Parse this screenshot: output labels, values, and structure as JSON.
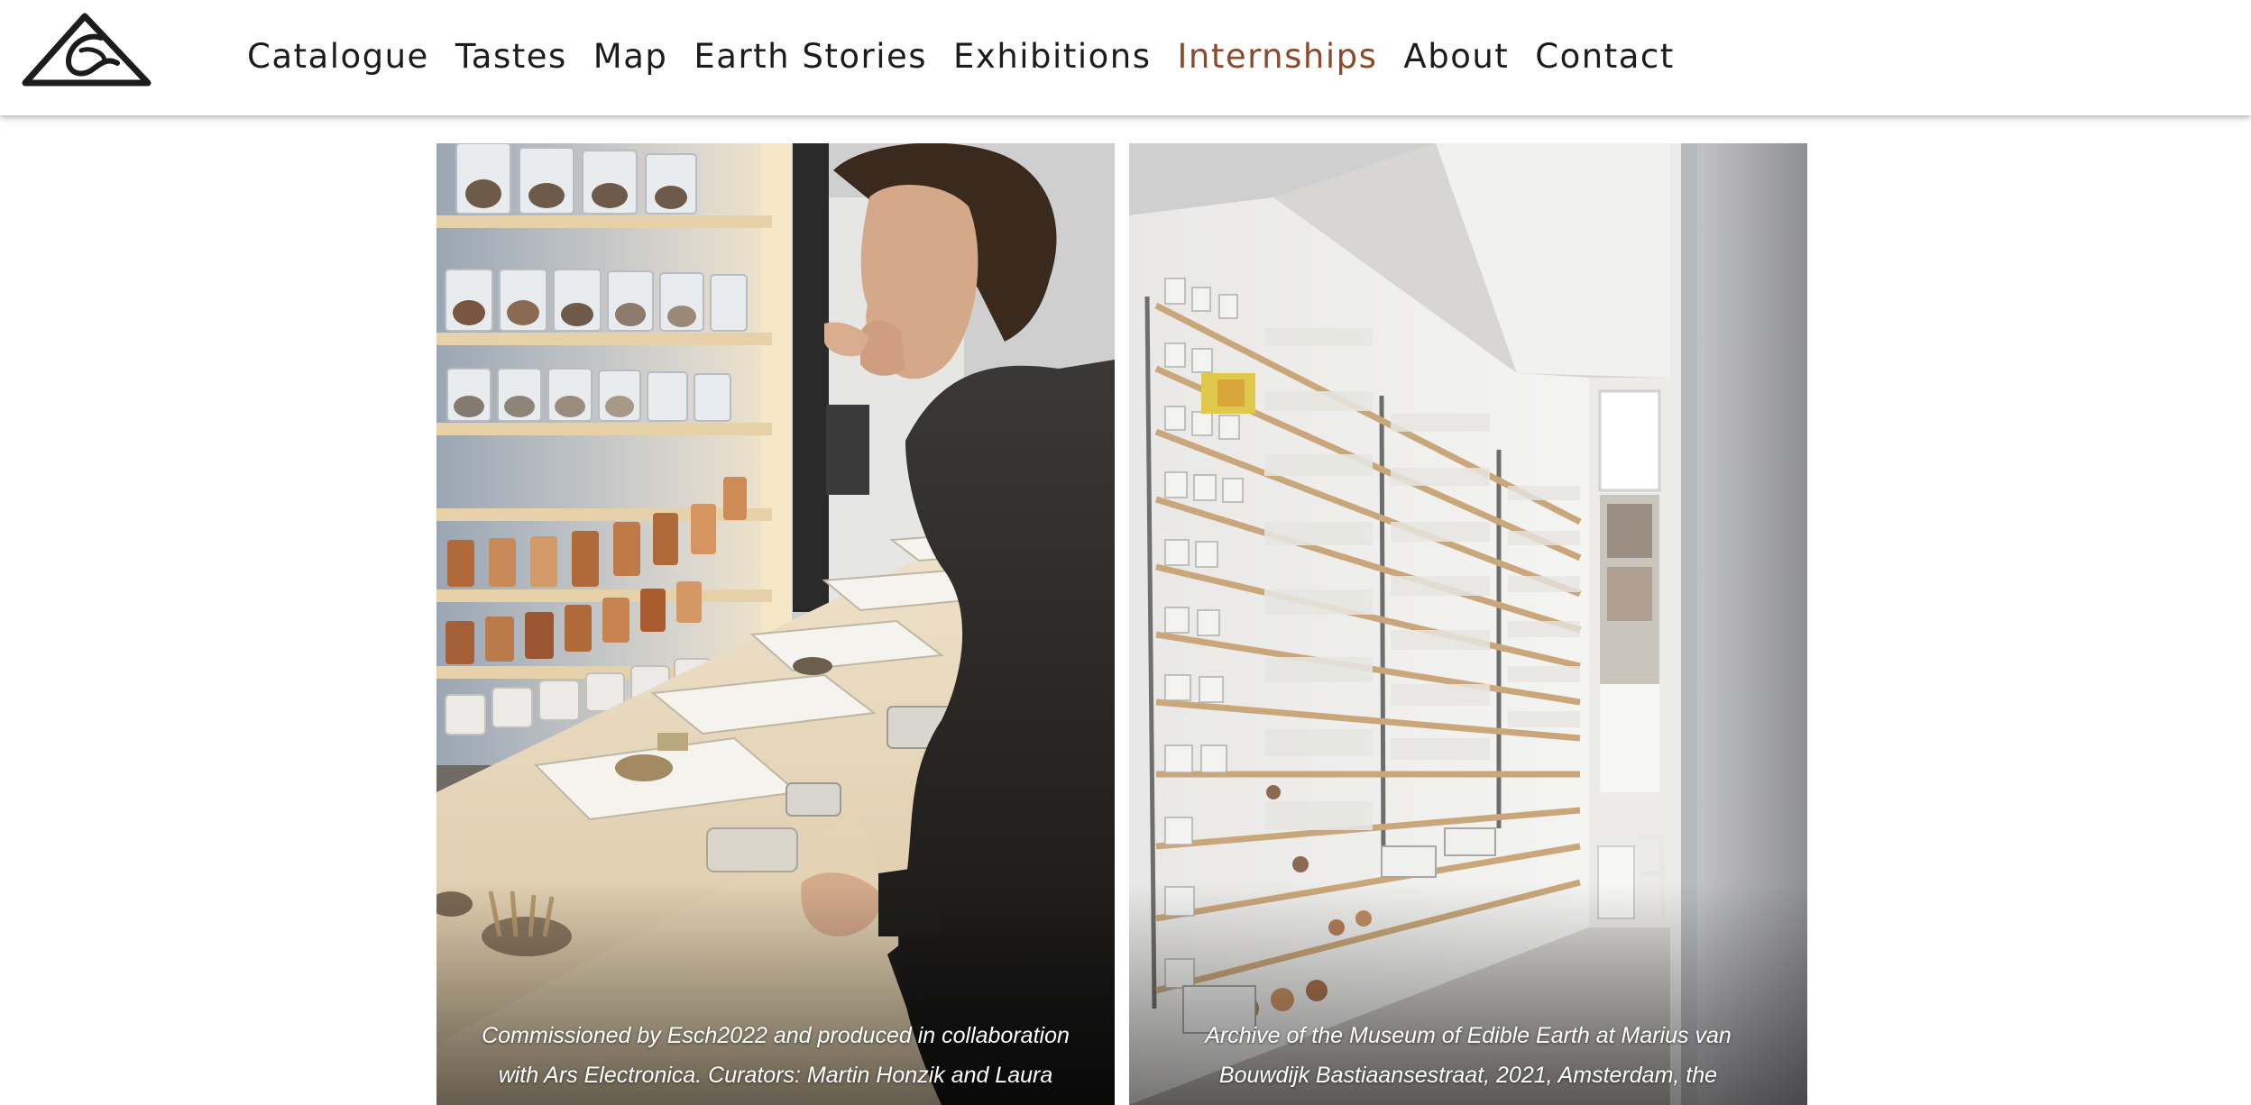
{
  "site": {
    "logo_icon": "mountain-stone-logo-icon"
  },
  "nav": {
    "items": [
      {
        "label": "Catalogue"
      },
      {
        "label": "Tastes"
      },
      {
        "label": "Map"
      },
      {
        "label": "Earth Stories"
      },
      {
        "label": "Exhibitions"
      },
      {
        "label": "Internships",
        "active": true
      },
      {
        "label": "About"
      },
      {
        "label": "Contact"
      }
    ],
    "active_color": "#8b4a2b",
    "text_color": "#1c1c1c"
  },
  "gallery": {
    "images": [
      {
        "caption_line1": "Commissioned by Esch2022 and produced in collaboration",
        "caption_line2": "with Ars Electronica. Curators: Martin Honzik and Laura"
      },
      {
        "caption_line1": "Archive of the Museum of Edible Earth at Marius van",
        "caption_line2": "Bouwdijk Bastiaansestraat, 2021, Amsterdam, the"
      }
    ]
  }
}
